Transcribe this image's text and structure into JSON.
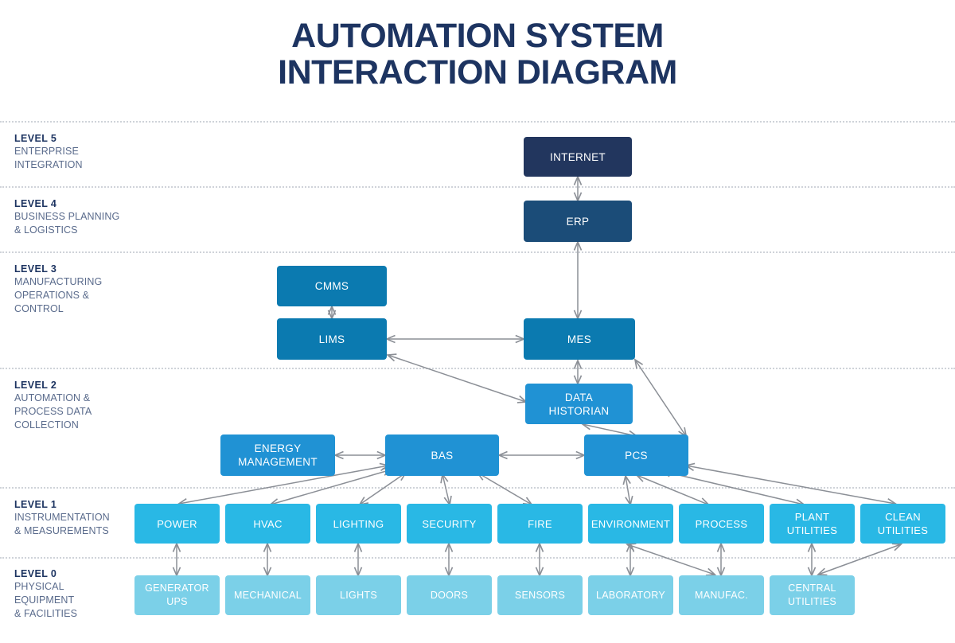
{
  "title": {
    "line1": "AUTOMATION SYSTEM",
    "line2": "INTERACTION DIAGRAM"
  },
  "colors": {
    "title": "#1d3461",
    "level5": "#22365e",
    "level4": "#1b4c78",
    "level3": "#0b7ab0",
    "level2": "#2092d4",
    "level1": "#29b8e5",
    "level0": "#7bd0e8",
    "arrow": "#8b8f96",
    "divider": "#cfd3d9",
    "label_text": "#5a6b8c"
  },
  "levels": [
    {
      "id": "level5",
      "title": "LEVEL 5",
      "desc": "ENTERPRISE\nINTEGRATION",
      "desc_lines": [
        "ENTERPRISE",
        "INTEGRATION"
      ]
    },
    {
      "id": "level4",
      "title": "LEVEL 4",
      "desc_lines": [
        "BUSINESS PLANNING",
        "& LOGISTICS"
      ]
    },
    {
      "id": "level3",
      "title": "LEVEL 3",
      "desc_lines": [
        "MANUFACTURING",
        "OPERATIONS &",
        "CONTROL"
      ]
    },
    {
      "id": "level2",
      "title": "LEVEL 2",
      "desc_lines": [
        "AUTOMATION &",
        "PROCESS DATA",
        "COLLECTION"
      ]
    },
    {
      "id": "level1",
      "title": "LEVEL 1",
      "desc_lines": [
        "INSTRUMENTATION",
        "& MEASUREMENTS"
      ]
    },
    {
      "id": "level0",
      "title": "LEVEL 0",
      "desc_lines": [
        "PHYSICAL",
        "EQUIPMENT",
        "& FACILITIES"
      ]
    }
  ],
  "nodes": {
    "internet": "INTERNET",
    "erp": "ERP",
    "cmms": "CMMS",
    "lims": "LIMS",
    "mes": "MES",
    "data_historian_l1": "DATA",
    "data_historian_l2": "HISTORIAN",
    "energy_mgmt_l1": "ENERGY",
    "energy_mgmt_l2": "MANAGEMENT",
    "bas": "BAS",
    "pcs": "PCS",
    "power": "POWER",
    "hvac": "HVAC",
    "lighting": "LIGHTING",
    "security": "SECURITY",
    "fire": "FIRE",
    "environment": "ENVIRONMENT",
    "process": "PROCESS",
    "plant_utilities_l1": "PLANT",
    "plant_utilities_l2": "UTILITIES",
    "clean_utilities_l1": "CLEAN",
    "clean_utilities_l2": "UTILITIES",
    "generator_ups_l1": "GENERATOR",
    "generator_ups_l2": "UPS",
    "mechanical": "MECHANICAL",
    "lights": "LIGHTS",
    "doors": "DOORS",
    "sensors": "SENSORS",
    "laboratory": "LABORATORY",
    "manufac": "MANUFAC.",
    "central_utilities_l1": "CENTRAL",
    "central_utilities_l2": "UTILITIES"
  },
  "connections": [
    {
      "from": "INTERNET",
      "to": "ERP",
      "type": "bidirectional"
    },
    {
      "from": "ERP",
      "to": "MES",
      "type": "bidirectional"
    },
    {
      "from": "CMMS",
      "to": "LIMS",
      "type": "bidirectional"
    },
    {
      "from": "LIMS",
      "to": "MES",
      "type": "bidirectional"
    },
    {
      "from": "LIMS",
      "to": "DATA HISTORIAN",
      "type": "bidirectional"
    },
    {
      "from": "MES",
      "to": "DATA HISTORIAN",
      "type": "bidirectional"
    },
    {
      "from": "MES",
      "to": "PCS",
      "type": "bidirectional"
    },
    {
      "from": "DATA HISTORIAN",
      "to": "PCS",
      "type": "bidirectional"
    },
    {
      "from": "ENERGY MANAGEMENT",
      "to": "BAS",
      "type": "bidirectional"
    },
    {
      "from": "BAS",
      "to": "PCS",
      "type": "bidirectional"
    },
    {
      "from": "BAS",
      "to": "POWER",
      "type": "bidirectional"
    },
    {
      "from": "BAS",
      "to": "HVAC",
      "type": "bidirectional"
    },
    {
      "from": "BAS",
      "to": "LIGHTING",
      "type": "bidirectional"
    },
    {
      "from": "BAS",
      "to": "SECURITY",
      "type": "bidirectional"
    },
    {
      "from": "BAS",
      "to": "FIRE",
      "type": "bidirectional"
    },
    {
      "from": "PCS",
      "to": "ENVIRONMENT",
      "type": "bidirectional"
    },
    {
      "from": "PCS",
      "to": "PROCESS",
      "type": "bidirectional"
    },
    {
      "from": "PCS",
      "to": "PLANT UTILITIES",
      "type": "bidirectional"
    },
    {
      "from": "PCS",
      "to": "CLEAN UTILITIES",
      "type": "bidirectional"
    },
    {
      "from": "POWER",
      "to": "GENERATOR UPS",
      "type": "bidirectional"
    },
    {
      "from": "HVAC",
      "to": "MECHANICAL",
      "type": "bidirectional"
    },
    {
      "from": "LIGHTING",
      "to": "LIGHTS",
      "type": "bidirectional"
    },
    {
      "from": "SECURITY",
      "to": "DOORS",
      "type": "bidirectional"
    },
    {
      "from": "FIRE",
      "to": "SENSORS",
      "type": "bidirectional"
    },
    {
      "from": "ENVIRONMENT",
      "to": "LABORATORY",
      "type": "bidirectional"
    },
    {
      "from": "PROCESS",
      "to": "MANUFAC.",
      "type": "bidirectional"
    },
    {
      "from": "PLANT UTILITIES",
      "to": "CENTRAL UTILITIES",
      "type": "bidirectional"
    },
    {
      "from": "CLEAN UTILITIES",
      "to": "CENTRAL UTILITIES",
      "type": "bidirectional"
    },
    {
      "from": "ENVIRONMENT",
      "to": "MANUFAC.",
      "type": "bidirectional"
    }
  ]
}
